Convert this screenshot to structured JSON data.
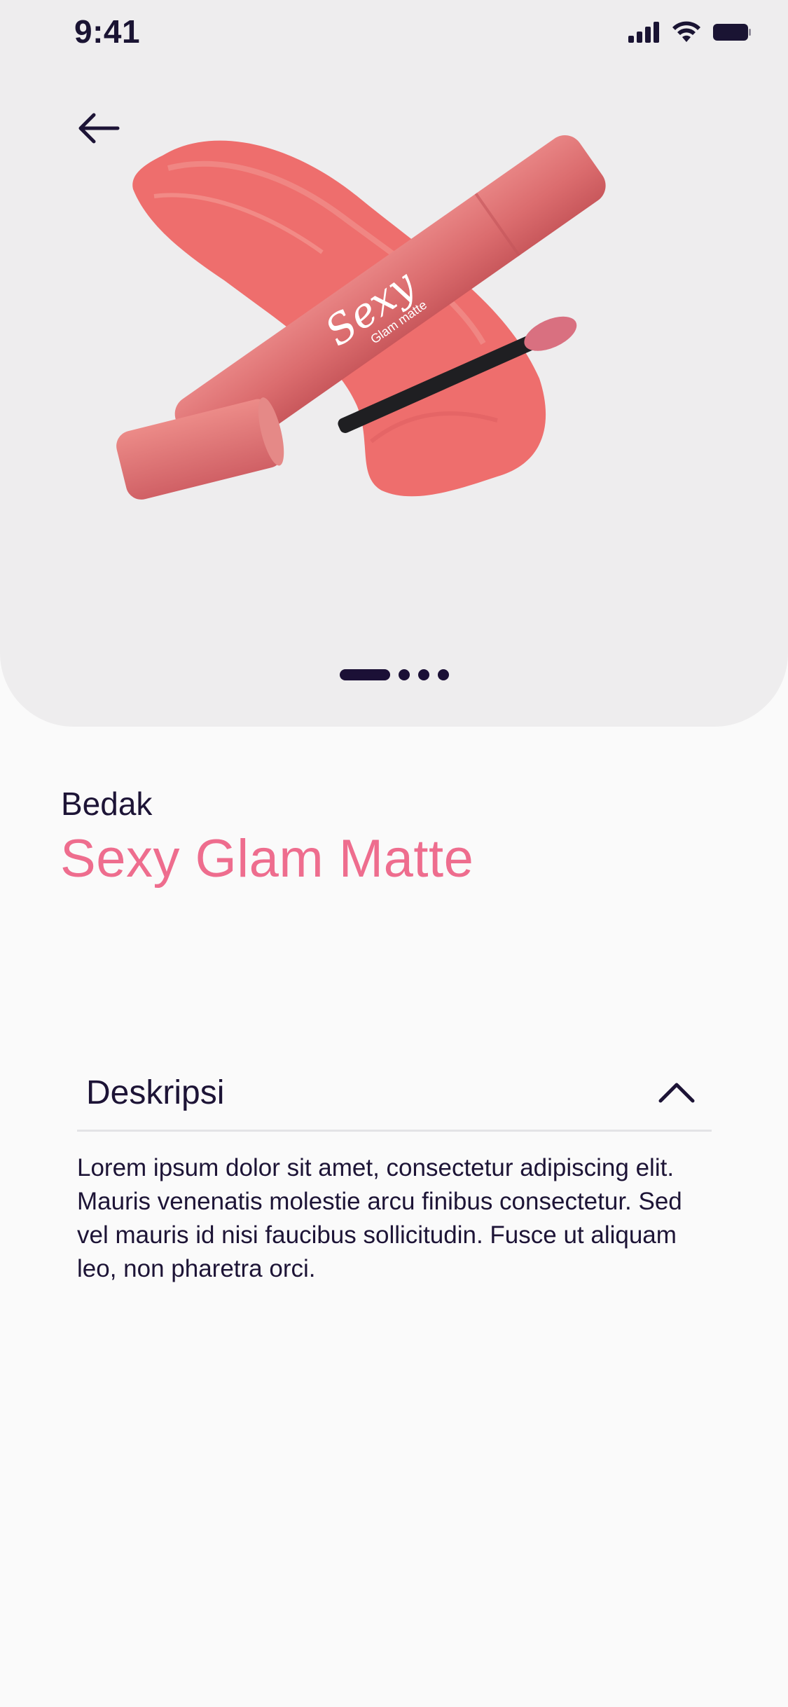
{
  "status_bar": {
    "time": "9:41"
  },
  "hero": {
    "back_icon": "arrow-left-icon",
    "image_alt": "Sexy Glam Matte lip cream",
    "brand_script": "Sexy",
    "brand_subtitle": "Glam matte",
    "pager_count": 4,
    "pager_active_index": 0
  },
  "product": {
    "category": "Bedak",
    "name": "Sexy Glam Matte"
  },
  "description": {
    "title": "Deskripsi",
    "expanded": true,
    "toggle_icon": "chevron-up-icon",
    "text": "Lorem ipsum dolor sit amet, consectetur adipiscing elit. Mauris venenatis molestie arcu finibus consectetur. Sed vel mauris id nisi faucibus sollicitudin. Fusce ut aliquam leo, non pharetra orci."
  },
  "colors": {
    "accent": "#ee6d8e",
    "text": "#1d1436",
    "hero_bg": "#eeedee",
    "page_bg": "#fafafa",
    "product": "#de6f6f"
  }
}
